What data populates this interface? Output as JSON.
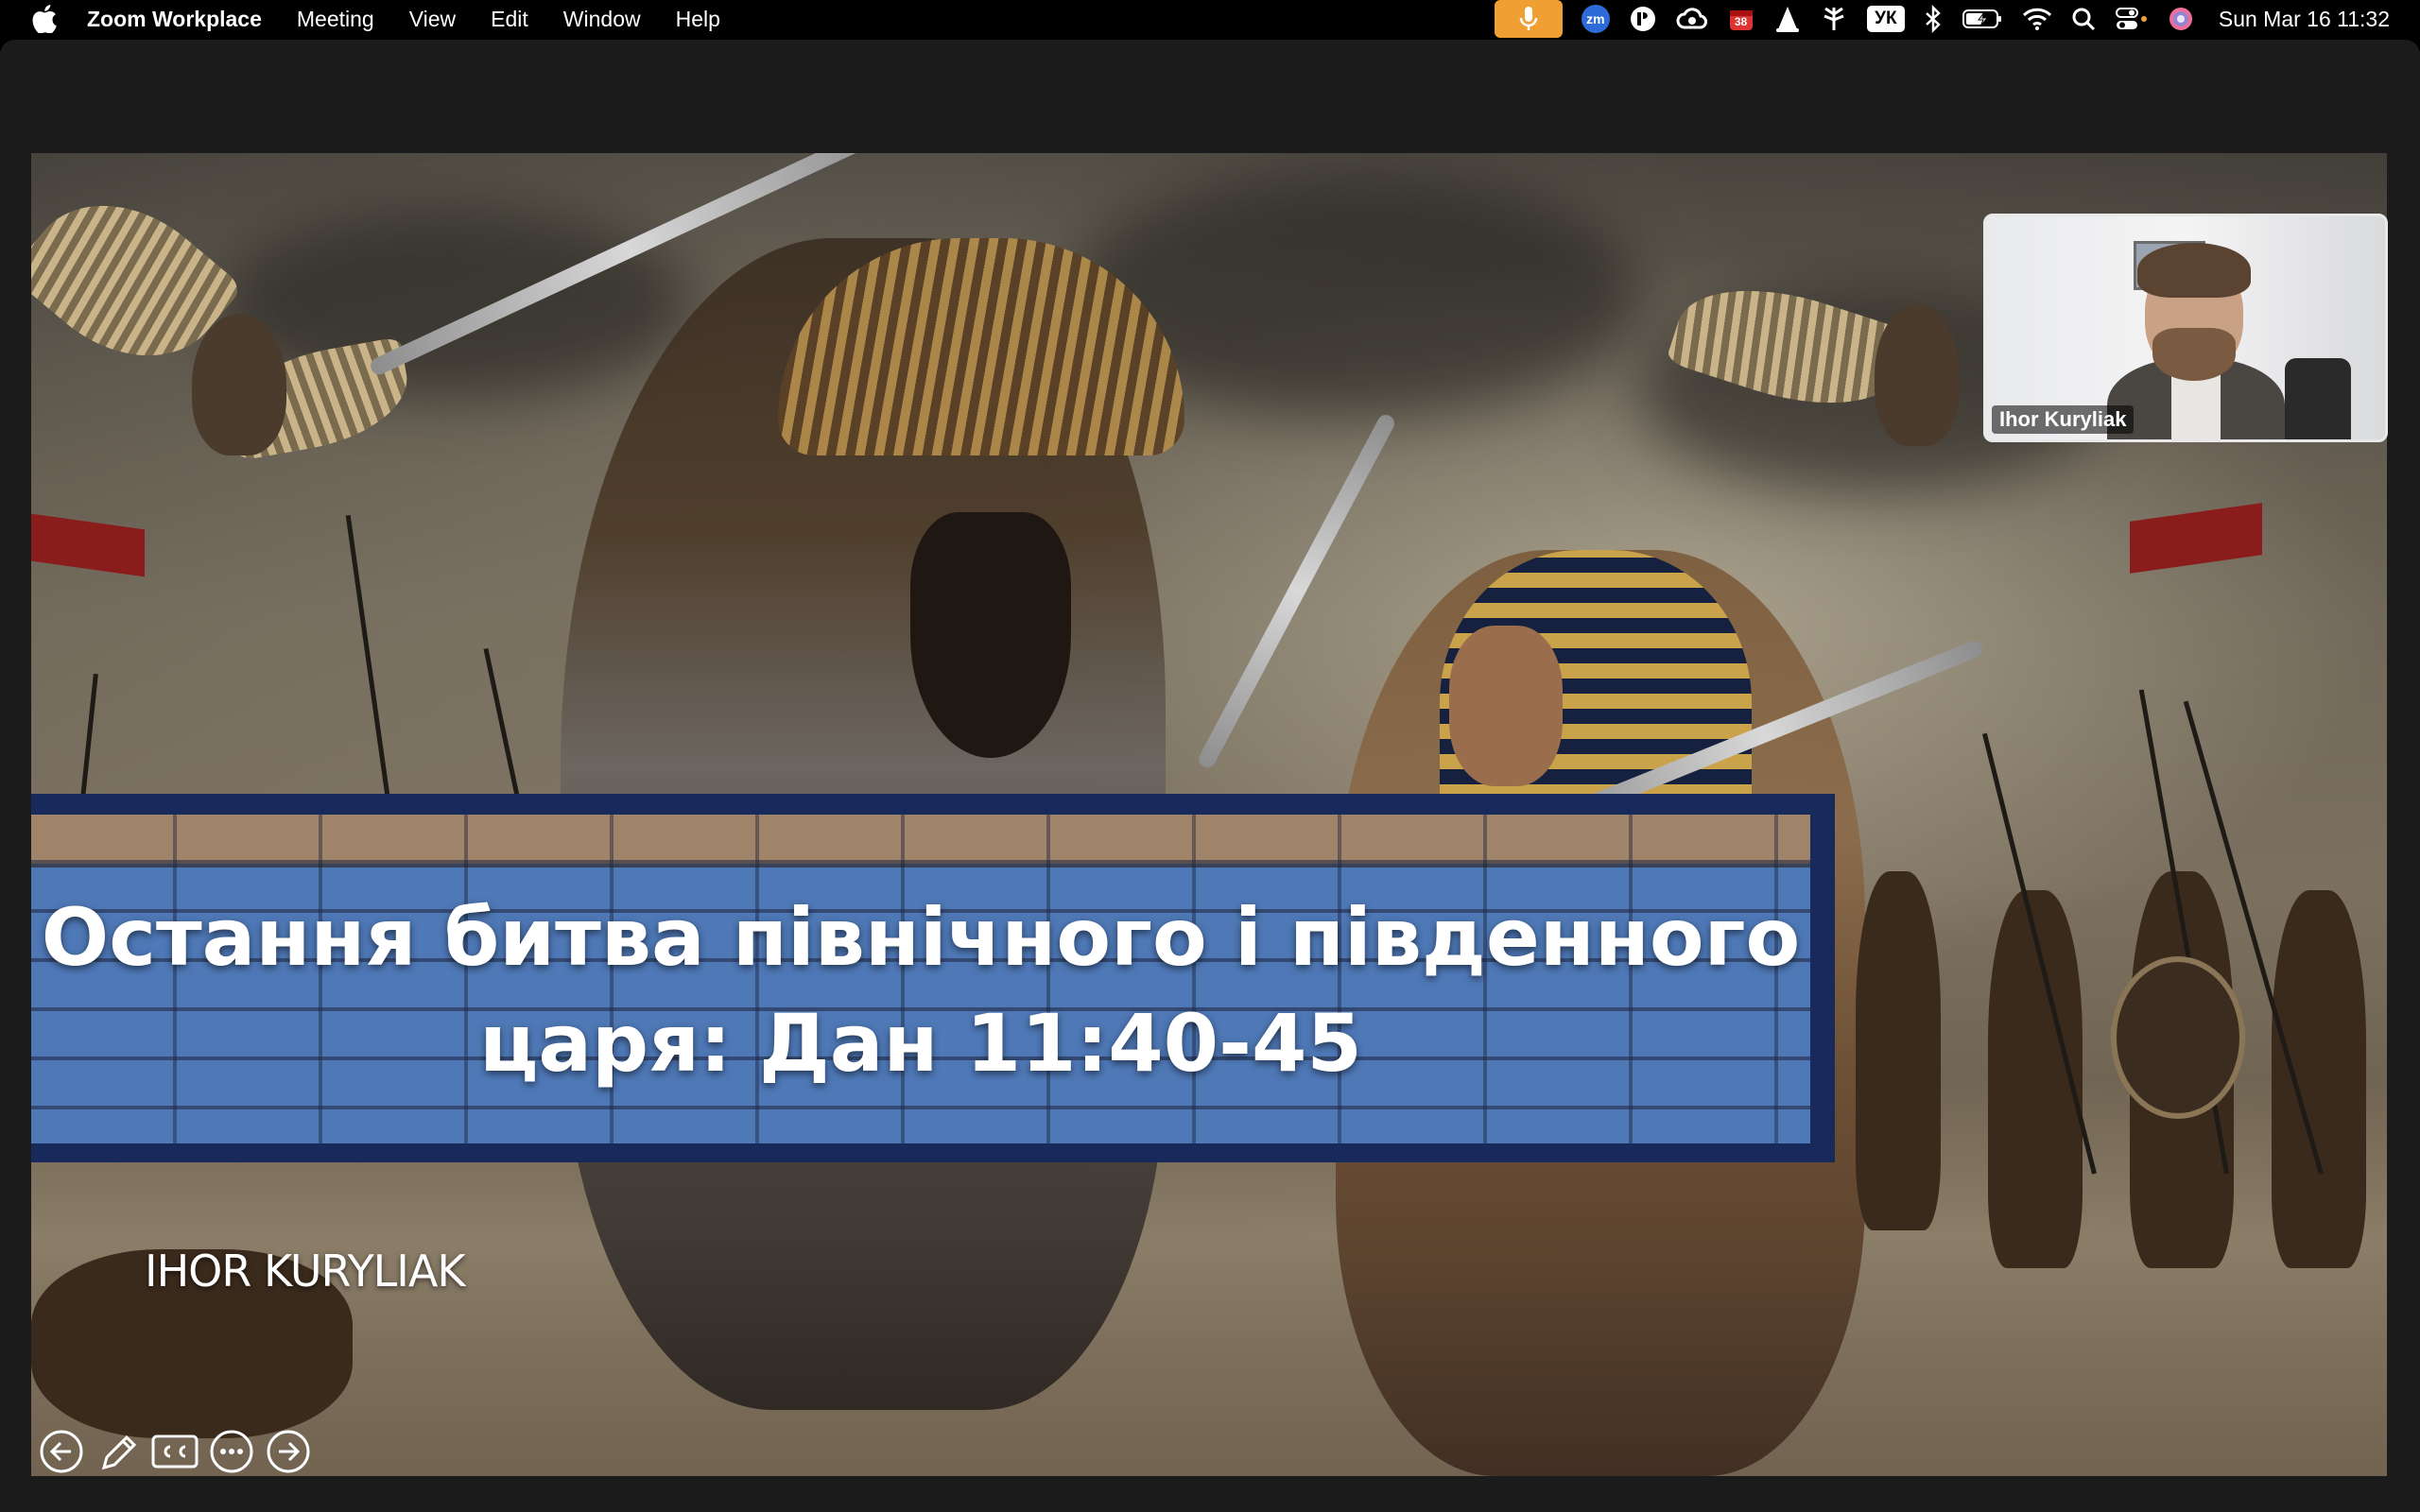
{
  "menubar": {
    "apple_icon": "apple-logo-icon",
    "app_name": "Zoom Workplace",
    "menus": [
      "Meeting",
      "View",
      "Edit",
      "Window",
      "Help"
    ],
    "status_icons": [
      "microphone-icon",
      "zoom-icon",
      "vpn-icon",
      "creative-cloud-icon",
      "calendar-icon",
      "vlc-icon",
      "tree-icon",
      "keyboard-layout",
      "bluetooth-icon",
      "battery-icon",
      "wifi-icon",
      "search-icon",
      "control-center-icon",
      "siri-icon"
    ],
    "notification_count": "38",
    "keyboard_layout": "УК",
    "zoom_badge": "zm",
    "datetime": "Sun Mar 16  11:32",
    "accent_color": "#f0a032"
  },
  "slide": {
    "title": "Остання битва північного і південного царя: Дан 11:40-45",
    "author": "IHOR KURYLIAK",
    "banner_color": "#182a5c",
    "toolbar": [
      {
        "name": "previous-slide-button",
        "icon": "arrow-left-circle-icon"
      },
      {
        "name": "pen-button",
        "icon": "pen-icon"
      },
      {
        "name": "captions-button",
        "icon": "closed-captions-icon"
      },
      {
        "name": "more-options-button",
        "icon": "ellipsis-circle-icon"
      },
      {
        "name": "next-slide-button",
        "icon": "arrow-right-circle-icon"
      }
    ]
  },
  "participant": {
    "name": "Ihor Kuryliak"
  }
}
